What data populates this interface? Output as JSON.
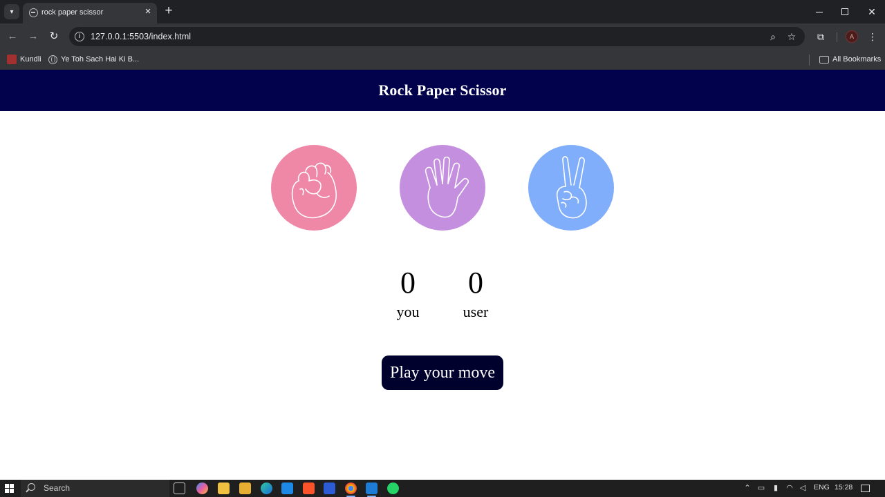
{
  "browser": {
    "tab_title": "rock paper scissor",
    "url": "127.0.0.1:5503/index.html",
    "bookmarks": [
      {
        "label": "Kundli"
      },
      {
        "label": "Ye Toh Sach Hai Ki B..."
      }
    ],
    "all_bookmarks_label": "All Bookmarks"
  },
  "app": {
    "title": "Rock Paper Scissor",
    "choices": [
      {
        "id": "rock",
        "icon": "fist-hand-icon",
        "color": "#ef88a7"
      },
      {
        "id": "paper",
        "icon": "open-hand-icon",
        "color": "#c48fde"
      },
      {
        "id": "scissors",
        "icon": "victory-hand-icon",
        "color": "#81aefa"
      }
    ],
    "scores": {
      "you": {
        "value": "0",
        "label": "you"
      },
      "user": {
        "value": "0",
        "label": "user"
      }
    },
    "play_button_label": "Play your move",
    "header_color": "#01024b",
    "button_color": "#01012e"
  },
  "taskbar": {
    "search_label": "Search",
    "language": "ENG",
    "time": "15:28"
  }
}
